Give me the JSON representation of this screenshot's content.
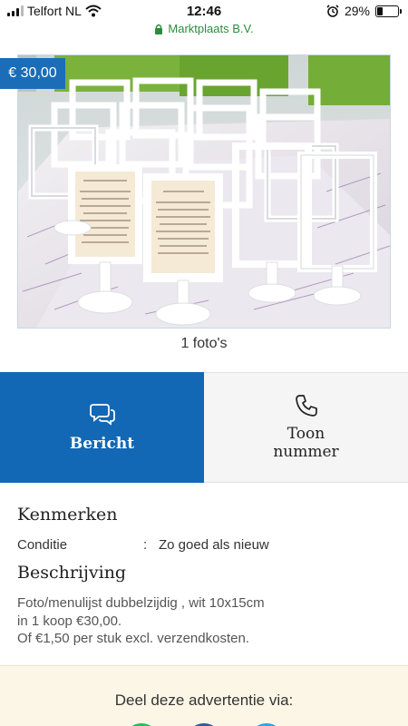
{
  "status_bar": {
    "carrier": "Telfort NL",
    "time": "12:46",
    "battery_percent": "29%",
    "battery_level": 0.29,
    "url": "Marktplaats B.V."
  },
  "listing": {
    "price": "€ 30,00",
    "photo_count": "1 foto's"
  },
  "actions": {
    "message_label": "Bericht",
    "phone_label": "Toon nummer"
  },
  "details": {
    "kenmerken_title": "Kenmerken",
    "properties": [
      {
        "key": "Conditie",
        "separator": ":",
        "value": "Zo goed als nieuw"
      }
    ],
    "beschrijving_title": "Beschrijving",
    "description_lines": [
      "Foto/menulijst dubbelzijdig , wit 10x15cm",
      "in 1 koop €30,00.",
      "Of €1,50 per stuk excl. verzendkosten."
    ]
  },
  "share": {
    "title": "Deel deze advertentie via:"
  },
  "colors": {
    "brand_blue": "#1268b4",
    "secure_green": "#2c8c3c",
    "share_bg": "#fbf6e6"
  }
}
